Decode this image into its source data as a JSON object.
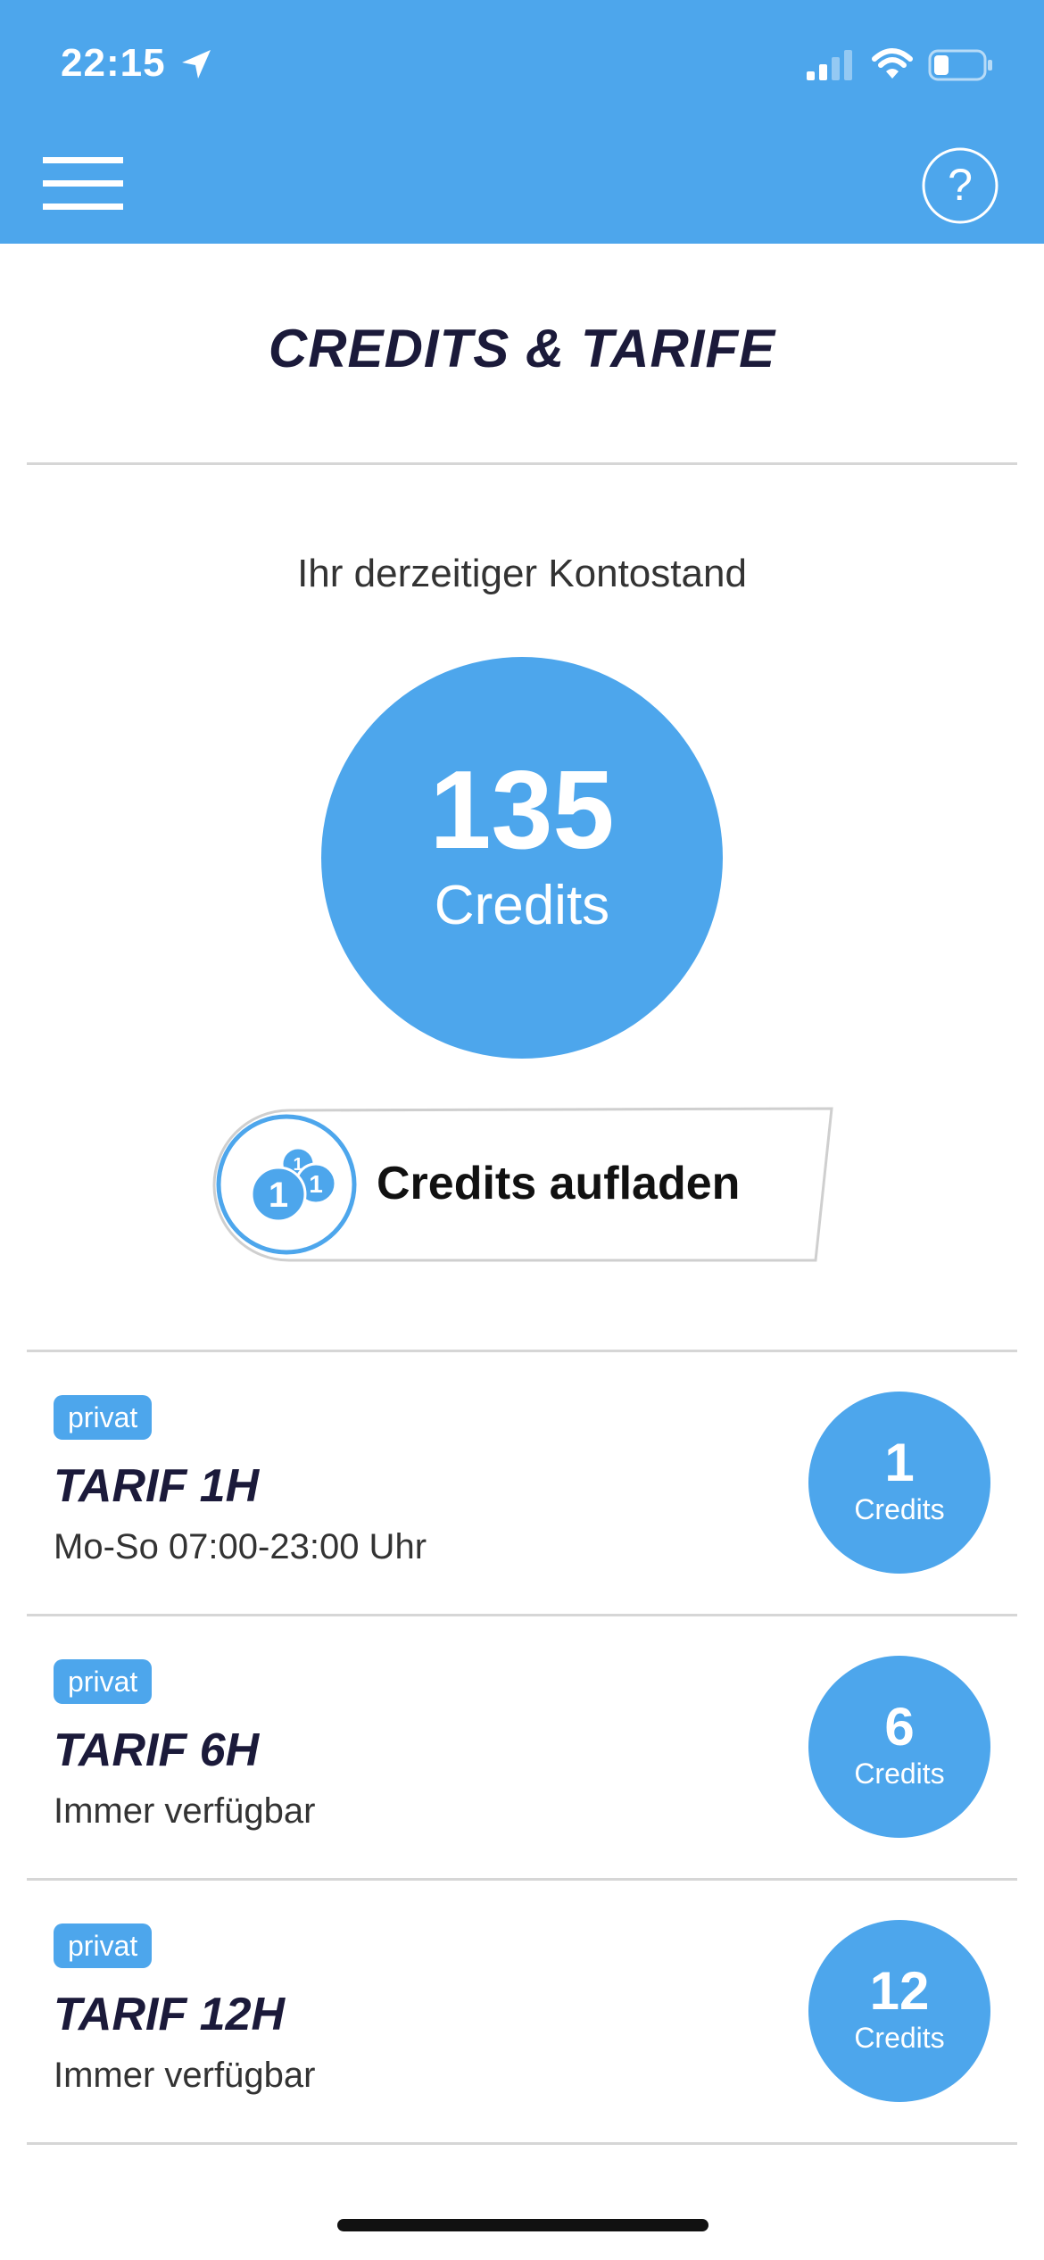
{
  "status_bar": {
    "time": "22:15"
  },
  "header": {
    "menu_icon": "hamburger-menu-icon",
    "help_icon": "help-question-icon"
  },
  "page": {
    "title": "CREDITS & TARIFE"
  },
  "balance": {
    "label": "Ihr derzeitiger Kontostand",
    "value": "135",
    "unit": "Credits"
  },
  "topup": {
    "label": "Credits aufladen",
    "icon": "coins-icon"
  },
  "tariffs": [
    {
      "tag": "privat",
      "name": "TARIF 1H",
      "desc": "Mo-So 07:00-23:00 Uhr",
      "credits": "1",
      "unit": "Credits"
    },
    {
      "tag": "privat",
      "name": "TARIF 6H",
      "desc": "Immer verfügbar",
      "credits": "6",
      "unit": "Credits"
    },
    {
      "tag": "privat",
      "name": "TARIF 12H",
      "desc": "Immer verfügbar",
      "credits": "12",
      "unit": "Credits"
    }
  ],
  "colors": {
    "accent": "#4da6ec",
    "title": "#1b1a3a"
  }
}
